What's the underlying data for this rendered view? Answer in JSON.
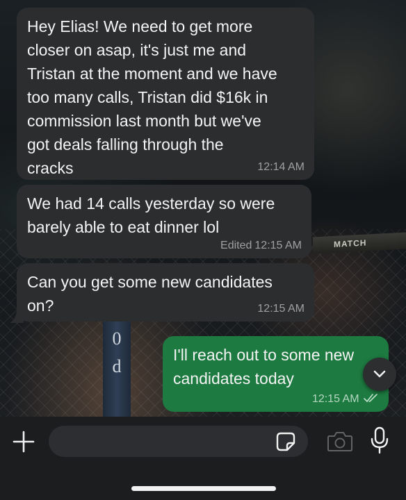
{
  "messages": [
    {
      "direction": "incoming",
      "text": "Hey Elias! We need to get more\ncloser on asap, it's just me and\nTristan at the moment and we have\ntoo many calls, Tristan did $16k in\ncommission last month but we've\ngot deals falling through the\ncracks",
      "time": "12:14 AM"
    },
    {
      "direction": "incoming",
      "text": "We had 14 calls yesterday so were\nbarely able to eat dinner lol",
      "edited_label": "Edited",
      "time": "12:15 AM"
    },
    {
      "direction": "incoming",
      "text": "Can you get some new candidates\non?",
      "time": "12:15 AM"
    },
    {
      "direction": "outgoing",
      "text": "I'll reach out to some new\ncandidates today",
      "time": "12:15 AM",
      "status": "read"
    }
  ],
  "wallpaper": {
    "pole_text": "0\nd",
    "sign_text": "MATCH"
  },
  "composer": {
    "input_value": "",
    "input_placeholder": ""
  },
  "icons": {
    "add": "plus-icon",
    "sticker": "sticker-icon",
    "camera": "camera-icon",
    "mic": "microphone-icon",
    "scroll": "chevron-down-icon",
    "read_receipt": "double-check-icon"
  },
  "colors": {
    "incoming_bubble": "#2b2d2f",
    "outgoing_bubble": "#1d7a40",
    "composer_bg": "#1b1d1f",
    "read_tick": "#bfe3cc"
  }
}
